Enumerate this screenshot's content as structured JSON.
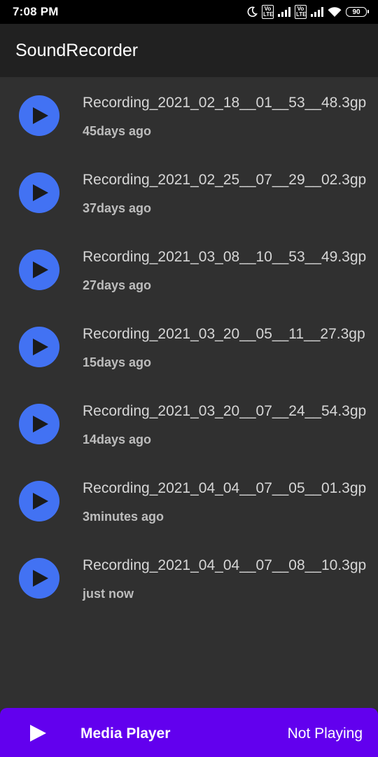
{
  "status_bar": {
    "time": "7:08 PM",
    "volte_1": "Vo LTE",
    "volte_2": "Vo LTE",
    "battery": "90",
    "icons": [
      "moon-icon",
      "volte-icon",
      "signal-icon",
      "volte-icon",
      "signal-icon",
      "wifi-icon",
      "battery-icon"
    ]
  },
  "app_bar": {
    "title": "SoundRecorder"
  },
  "recordings": [
    {
      "name": "Recording_2021_02_18__01__53__48.3gp",
      "time": "45days ago"
    },
    {
      "name": "Recording_2021_02_25__07__29__02.3gp",
      "time": "37days ago"
    },
    {
      "name": "Recording_2021_03_08__10__53__49.3gp",
      "time": "27days ago"
    },
    {
      "name": "Recording_2021_03_20__05__11__27.3gp",
      "time": "15days ago"
    },
    {
      "name": "Recording_2021_03_20__07__24__54.3gp",
      "time": "14days ago"
    },
    {
      "name": "Recording_2021_04_04__07__05__01.3gp",
      "time": "3minutes ago"
    },
    {
      "name": "Recording_2021_04_04__07__08__10.3gp",
      "time": "just now"
    }
  ],
  "media_player": {
    "title": "Media Player",
    "status": "Not Playing"
  },
  "colors": {
    "background": "#303030",
    "app_bar": "#212121",
    "play_button": "#4272f3",
    "media_bar": "#6200ee"
  }
}
